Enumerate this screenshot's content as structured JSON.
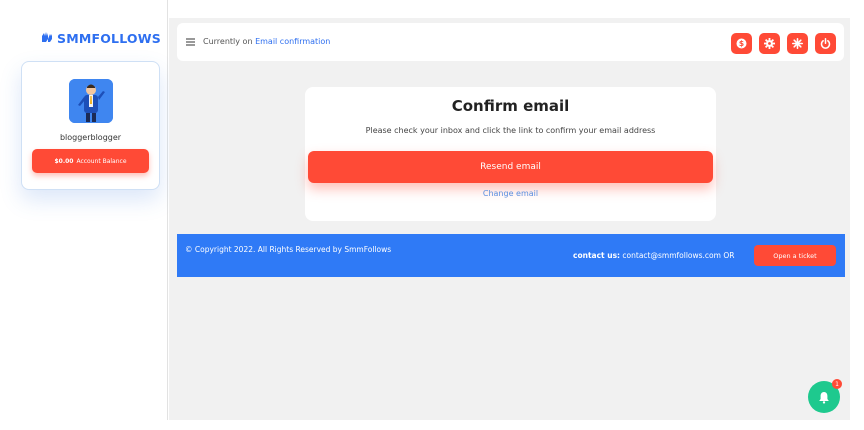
{
  "brand": {
    "logo_text": "SMMFOLLOWS",
    "logo_icon": "hands-icon",
    "accent": "#2e6ff0"
  },
  "profile": {
    "username": "bloggerblogger",
    "balance_amount": "$0.00",
    "balance_label": "Account Balance"
  },
  "topbar": {
    "prefix": "Currently on",
    "current_page": "Email confirmation",
    "icons": [
      "dollar-icon",
      "gear-icon",
      "asterisk-icon",
      "power-icon"
    ]
  },
  "confirm": {
    "title": "Confirm email",
    "message": "Please check your inbox and click the link to confirm your email address",
    "resend_label": "Resend email",
    "change_label": "Change email"
  },
  "footer": {
    "copyright": "© Copyright 2022. All Rights Reserved by SmmFollows",
    "contact_label": "contact us:",
    "contact_text": "contact@smmfollows.com OR",
    "ticket_label": "Open a ticket"
  },
  "notifications": {
    "count": "1"
  },
  "colors": {
    "primary_red": "#ff4a36",
    "footer_blue": "#2f7af6",
    "notify_green": "#1ec98e",
    "page_bg": "#f1f1f1"
  }
}
